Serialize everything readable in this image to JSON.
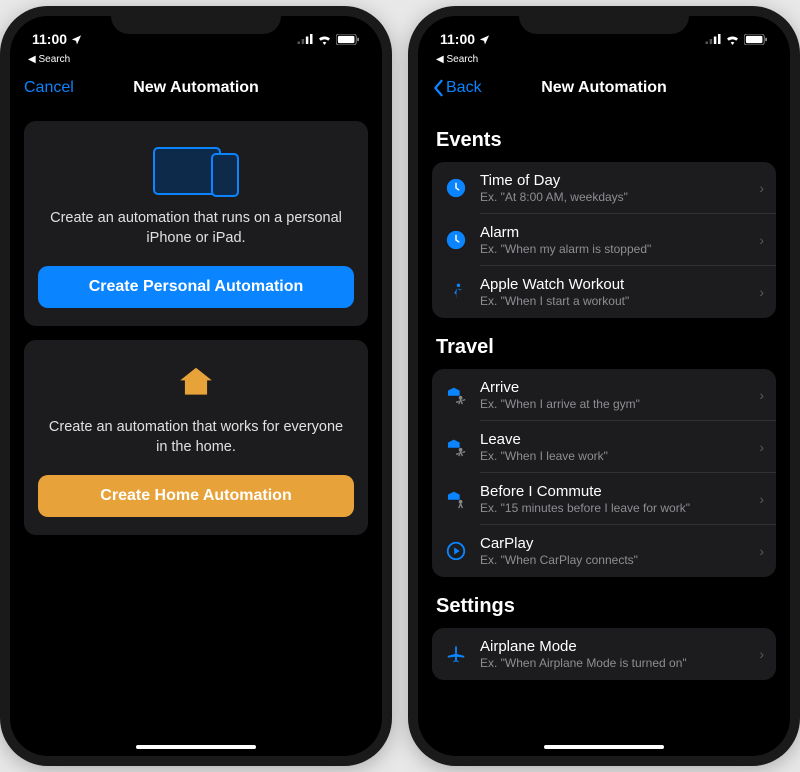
{
  "status": {
    "time": "11:00",
    "breadcrumb": "Search"
  },
  "phone1": {
    "cancel": "Cancel",
    "title": "New Automation",
    "personal": {
      "desc": "Create an automation that runs on a personal iPhone or iPad.",
      "button": "Create Personal Automation"
    },
    "home": {
      "desc": "Create an automation that works for everyone in the home.",
      "button": "Create Home Automation"
    }
  },
  "phone2": {
    "back": "Back",
    "title": "New Automation",
    "sections": {
      "events": {
        "header": "Events"
      },
      "travel": {
        "header": "Travel"
      },
      "settings": {
        "header": "Settings"
      }
    },
    "rows": {
      "time_of_day": {
        "title": "Time of Day",
        "sub": "Ex. \"At 8:00 AM, weekdays\""
      },
      "alarm": {
        "title": "Alarm",
        "sub": "Ex. \"When my alarm is stopped\""
      },
      "workout": {
        "title": "Apple Watch Workout",
        "sub": "Ex. \"When I start a workout\""
      },
      "arrive": {
        "title": "Arrive",
        "sub": "Ex. \"When I arrive at the gym\""
      },
      "leave": {
        "title": "Leave",
        "sub": "Ex. \"When I leave work\""
      },
      "commute": {
        "title": "Before I Commute",
        "sub": "Ex. \"15 minutes before I leave for work\""
      },
      "carplay": {
        "title": "CarPlay",
        "sub": "Ex. \"When CarPlay connects\""
      },
      "airplane": {
        "title": "Airplane Mode",
        "sub": "Ex. \"When Airplane Mode is turned on\""
      }
    }
  },
  "colors": {
    "accent": "#0a84ff",
    "orange": "#e8a23a"
  }
}
